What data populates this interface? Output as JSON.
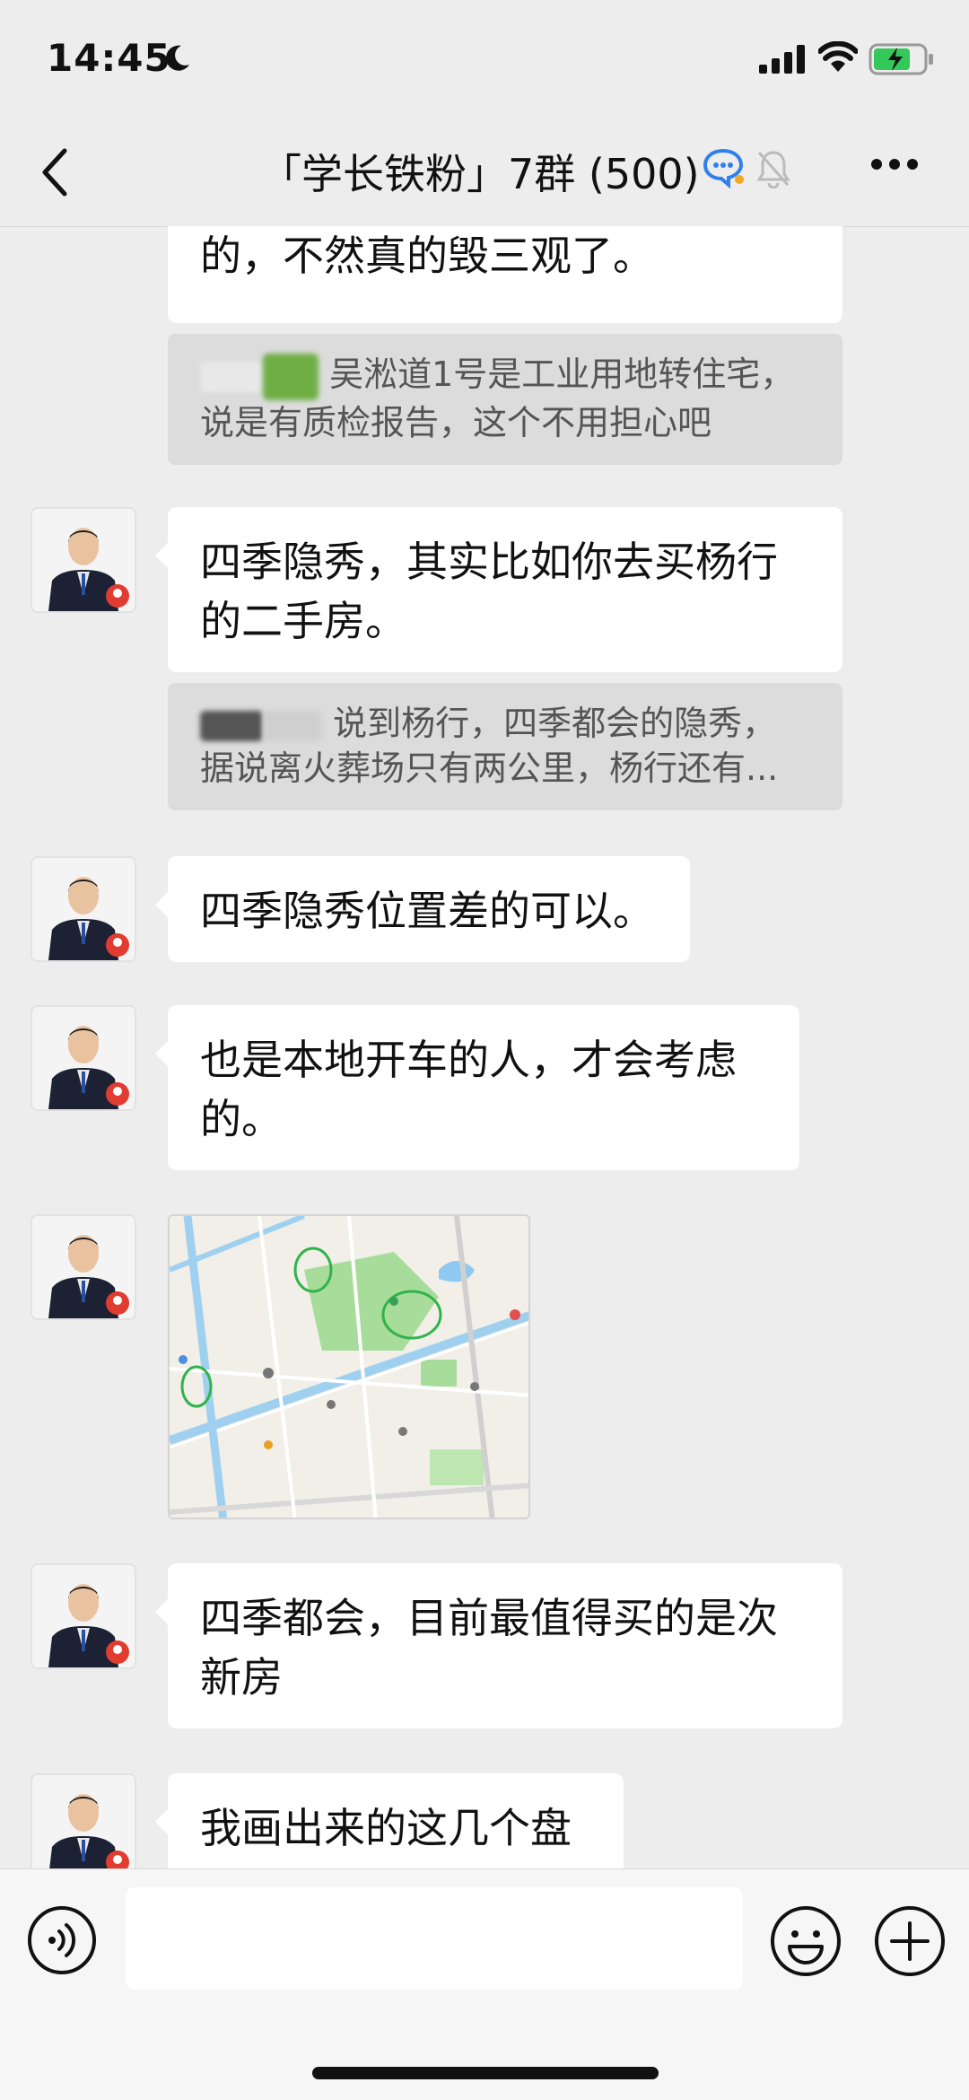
{
  "status_bar": {
    "time": "14:45"
  },
  "nav": {
    "title": "「学长铁粉」7群 (500)"
  },
  "messages": {
    "m0_partial": "的，不然真的毁三观了。",
    "q1_text": "吴淞道1号是工业用地转住宅，说是有质检报告，这个不用担心吧",
    "m1": "四季隐秀，其实比如你去买杨行的二手房。",
    "q2_text": "说到杨行，四季都会的隐秀，据说离火葬场只有两公里，杨行还有...",
    "m2": "四季隐秀位置差的可以。",
    "m3": "也是本地开车的人，才会考虑的。",
    "m4": "四季都会，目前最值得买的是次新房",
    "m5": "我画出来的这几个盘"
  },
  "colors": {
    "accent_green": "#07c160",
    "bubble": "#ffffff",
    "background": "#ededed"
  }
}
